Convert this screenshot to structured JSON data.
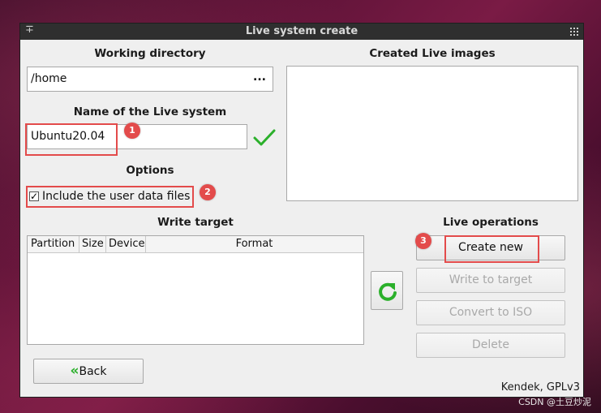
{
  "window": {
    "title": "Live system create"
  },
  "working_directory": {
    "label": "Working directory",
    "value": "/home",
    "browse_label": "..."
  },
  "created_images": {
    "label": "Created Live images"
  },
  "live_system_name": {
    "label": "Name of the Live system",
    "value": "Ubuntu20.04",
    "valid_icon": "checkmark-icon",
    "valid_color": "#2bb02b"
  },
  "options": {
    "label": "Options",
    "include_user_data": {
      "label": "Include the user data files",
      "checked": true,
      "check_glyph": "✓"
    }
  },
  "write_target": {
    "label": "Write target",
    "columns": [
      "Partition",
      "Size",
      "Device",
      "Format"
    ]
  },
  "live_operations": {
    "label": "Live operations",
    "create_new": "Create new",
    "write_to_target": "Write to target",
    "convert_to_iso": "Convert to ISO",
    "delete": "Delete"
  },
  "refresh": {
    "icon": "refresh-icon",
    "color": "#2bb02b"
  },
  "back": {
    "label": "Back",
    "icon": "double-chevron-left-icon",
    "glyph": "«",
    "color": "#2bb02b"
  },
  "footer": {
    "credit": "Kendek, GPLv3"
  },
  "annotations": {
    "badge1": "1",
    "badge2": "2",
    "badge3": "3",
    "color": "#e34b4b"
  },
  "watermark": "CSDN @土豆炒泥"
}
